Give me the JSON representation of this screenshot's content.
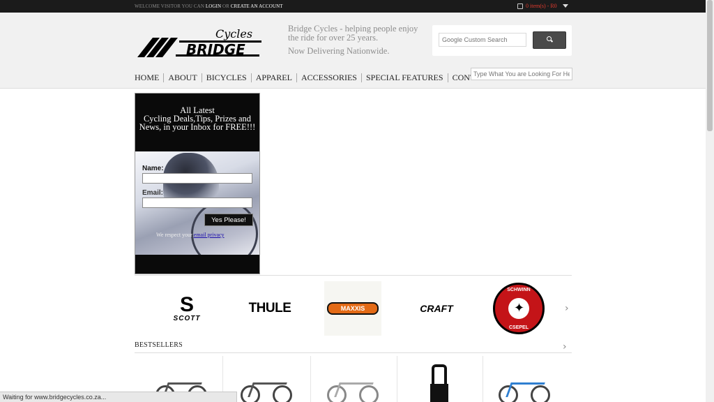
{
  "topbar": {
    "welcome": "WELCOME VISITOR YOU CAN",
    "login": "LOGIN",
    "or": "OR",
    "create_account": "CREATE AN ACCOUNT",
    "cart": "0 item(s) - R0"
  },
  "header": {
    "logo_script": "Cycles",
    "logo_main": "BRIDGE",
    "tagline": "Bridge Cycles - helping people enjoy the ride for over 25 years.",
    "tagline2": "Now Delivering Nationwide.",
    "google_search_placeholder": "Google Custom Search"
  },
  "nav": {
    "items": [
      "HOME",
      "ABOUT",
      "BICYCLES",
      "APPAREL",
      "ACCESSORIES",
      "SPECIAL FEATURES",
      "CONTACT"
    ],
    "search_placeholder": "Type What You are Looking For Here"
  },
  "newsletter": {
    "heading_line1": "All Latest",
    "heading_line2": "Cycling Deals,Tips, Prizes and News, in your Inbox for FREE!!!",
    "name_label": "Name:",
    "email_label": "Email:",
    "button": "Yes Please!",
    "privacy_text": "We respect your",
    "privacy_link": "email privacy"
  },
  "brands": {
    "scott_glyph": "S",
    "scott": "SCOTT",
    "thule": "THULE",
    "maxxis": "MAXXIS",
    "craft": "CRAFT",
    "schwinn_top": "SCHWINN",
    "schwinn_bottom": "CSEPEL"
  },
  "bestsellers": {
    "title": "BESTSELLERS"
  },
  "statusbar": "Waiting for www.bridgecycles.co.za..."
}
